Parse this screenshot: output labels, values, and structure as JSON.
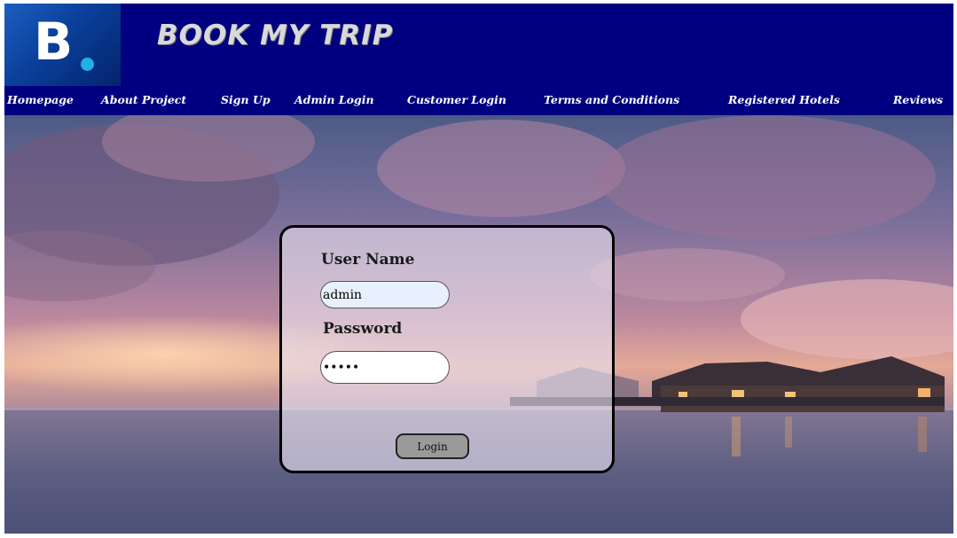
{
  "header": {
    "brand_title": "BOOK MY TRIP",
    "logo_letter": "B"
  },
  "nav": {
    "items": [
      {
        "label": "Homepage"
      },
      {
        "label": "About Project"
      },
      {
        "label": "Sign Up"
      },
      {
        "label": "Admin Login"
      },
      {
        "label": "Customer Login"
      },
      {
        "label": "Terms and Conditions"
      },
      {
        "label": "Registered Hotels"
      },
      {
        "label": "Reviews"
      }
    ]
  },
  "login": {
    "username_label": "User Name",
    "username_value": "admin",
    "password_label": "Password",
    "password_value": "•••••",
    "submit_label": "Login"
  },
  "colors": {
    "header_bg": "#000080",
    "accent_dot": "#1fb0e8",
    "button_bg": "#9a9a9a"
  }
}
